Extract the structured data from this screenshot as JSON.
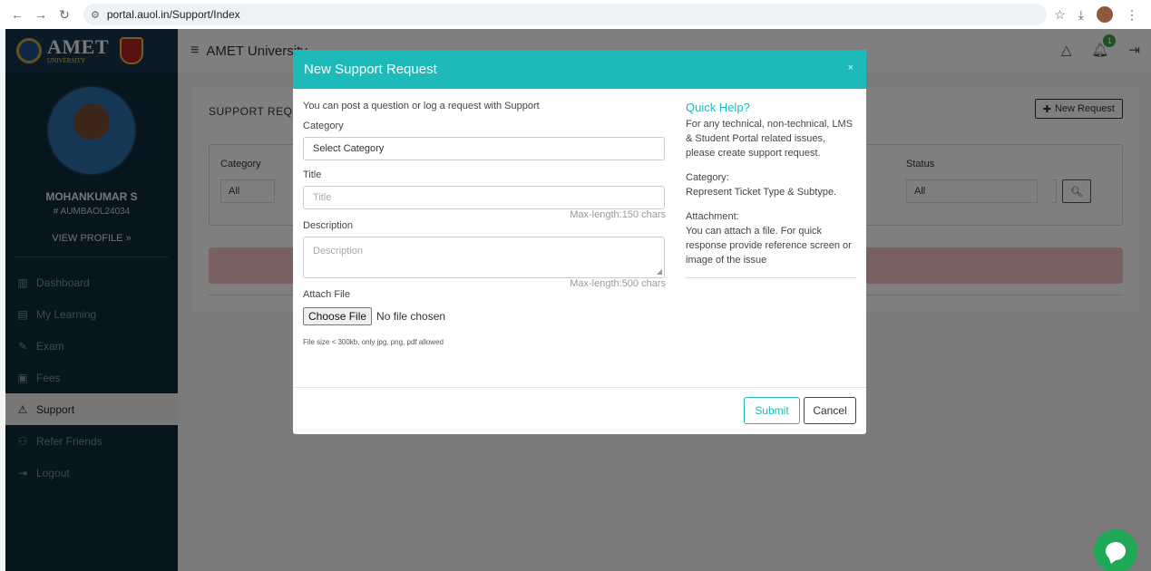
{
  "browser": {
    "url": "portal.auol.in/Support/Index"
  },
  "sidebar": {
    "logo_text": "AMET",
    "logo_sub": "UNIVERSITY",
    "profile_name": "MOHANKUMAR S",
    "profile_id": "# AUMBAOL24034",
    "view_profile": "VIEW PROFILE »",
    "items": [
      {
        "label": "Dashboard",
        "icon": "bar-chart-icon"
      },
      {
        "label": "My Learning",
        "icon": "book-icon"
      },
      {
        "label": "Exam",
        "icon": "edit-icon"
      },
      {
        "label": "Fees",
        "icon": "money-icon"
      },
      {
        "label": "Support",
        "icon": "warning-icon",
        "active": true
      },
      {
        "label": "Refer Friends",
        "icon": "add-user-icon"
      },
      {
        "label": "Logout",
        "icon": "logout-icon"
      }
    ]
  },
  "header": {
    "title": "AMET University",
    "notification_count": "1"
  },
  "page": {
    "card_title": "SUPPORT REQUESTS",
    "new_request": "New Request",
    "filter_category_label": "Category",
    "filter_category_value": "All",
    "filter_status_label": "Status",
    "filter_status_value": "All"
  },
  "modal": {
    "title": "New Support Request",
    "close": "×",
    "intro": "You can post a question or log a request with Support",
    "category_label": "Category",
    "category_value": "Select Category",
    "title_label": "Title",
    "title_placeholder": "Title",
    "title_maxlen": "Max-length:150 chars",
    "description_label": "Description",
    "description_placeholder": "Description",
    "description_maxlen": "Max-length:500 chars",
    "attach_label": "Attach File",
    "choose_file": "Choose File",
    "no_file": "No file chosen",
    "file_note": "File size < 300kb, only jpg, png, pdf allowed",
    "submit": "Submit",
    "cancel": "Cancel",
    "help": {
      "title": "Quick Help?",
      "intro": "For any technical, non-technical, LMS & Student Portal related issues, please create support request.",
      "category_head": "Category:",
      "category_text": "Represent Ticket Type & Subtype.",
      "attachment_head": "Attachment:",
      "attachment_text": "You can attach a file. For quick response provide reference screen or image of the issue"
    }
  },
  "colors": {
    "accent": "#1eb9b9",
    "sidebar": "#0e2a3f",
    "chat": "#1fa855",
    "alert": "#f3c2c2"
  }
}
